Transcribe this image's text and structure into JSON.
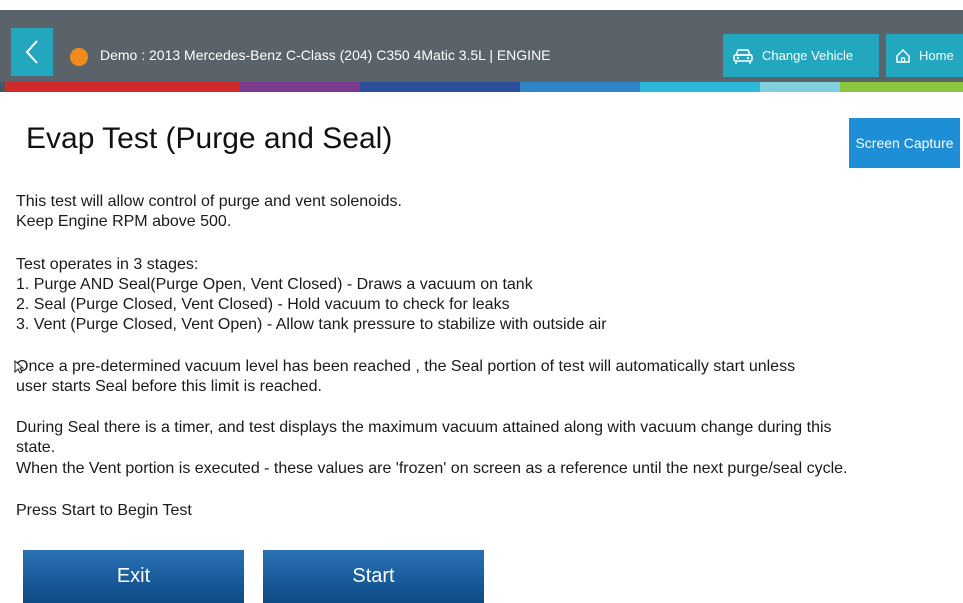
{
  "header": {
    "title": "Demo : 2013 Mercedes-Benz C-Class (204) C350 4Matic 3.5L | ENGINE",
    "status_color": "#f08a1c",
    "change_vehicle_label": "Change Vehicle",
    "home_label": "Home",
    "back_icon": "chevron-left-icon",
    "change_vehicle_icon": "car-icon",
    "home_icon": "home-icon"
  },
  "page": {
    "title": "Evap Test (Purge and Seal)",
    "screen_capture_label": "Screen Capture"
  },
  "instructions": [
    "This test will allow control of purge and vent solenoids.",
    "Keep Engine RPM above 500.",
    "Test operates in 3 stages:",
    "1. Purge AND Seal(Purge Open, Vent Closed) - Draws a vacuum on tank",
    "2. Seal (Purge Closed, Vent Closed) - Hold vacuum to check for leaks",
    "3. Vent (Purge Closed, Vent Open) - Allow tank pressure to stabilize with outside air",
    "Once a pre-determined vacuum level has been reached , the Seal portion of test will automatically start unless",
    "user starts Seal before this limit is reached.",
    "During Seal there is a timer, and test displays the maximum vacuum attained along with vacuum change during this",
    "state.",
    "When the Vent portion is executed - these values are 'frozen' on screen as a reference until the next purge/seal cycle.",
    "Press Start to Begin Test"
  ],
  "actions": {
    "exit_label": "Exit",
    "start_label": "Start"
  },
  "colors": {
    "header_bg": "#5a6369",
    "accent_teal": "#23a7be",
    "capture_blue": "#1e8fd6",
    "action_blue": "#0d4a86"
  }
}
